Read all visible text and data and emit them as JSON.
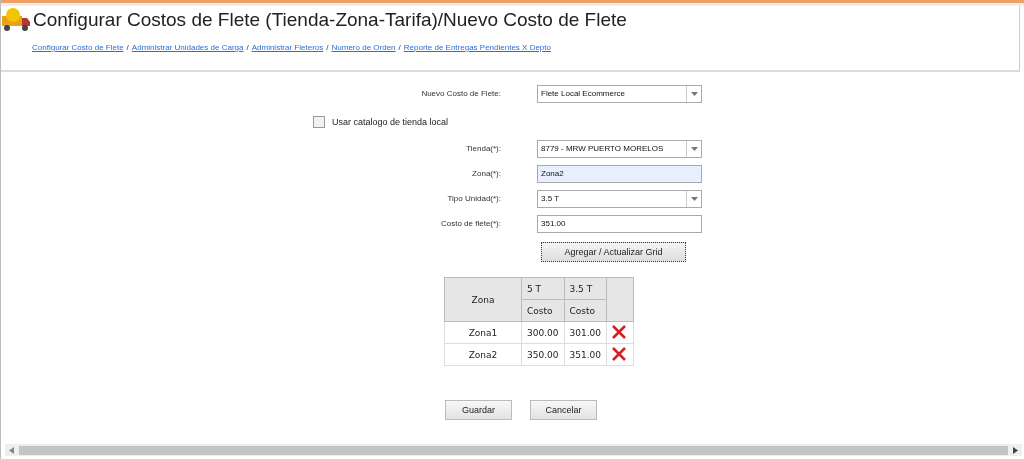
{
  "title": "Configurar Costos de Flete (Tienda-Zona-Tarifa)/Nuevo Costo de Flete",
  "breadcrumb_separator": "/",
  "breadcrumbs": [
    "Configurar Costo de Flete",
    "Administrar Unidades de Carga",
    "Administrar Fleteros",
    "Numero de Orden",
    "Reporte de Entregas Pendientes X Depto"
  ],
  "nuevo_costo": {
    "label": "Nuevo Costo de Flete:",
    "value": "Flete Local Ecommerce"
  },
  "usar_catalogo": {
    "label": "Usar catalogo de tienda local",
    "checked": false
  },
  "fields": [
    {
      "kind": "select",
      "label": "Tienda(*):",
      "value": "8779 - MRW PUERTO MORELOS"
    },
    {
      "kind": "input",
      "label": "Zona(*):",
      "value": "Zona2",
      "highlighted": true
    },
    {
      "kind": "select",
      "label": "Tipo Unidad(*):",
      "value": "3.5 T"
    },
    {
      "kind": "input",
      "label": "Costo de flete(*):",
      "value": "351.00",
      "highlighted": false
    }
  ],
  "add_button": "Agregar / Actualizar Grid",
  "table": {
    "zone_header": "Zona",
    "units": [
      {
        "name": "5 T",
        "sub": "Costo"
      },
      {
        "name": "3.5 T",
        "sub": "Costo"
      }
    ],
    "rows": [
      {
        "zona": "Zona1",
        "values": [
          "300.00",
          "301.00"
        ]
      },
      {
        "zona": "Zona2",
        "values": [
          "350.00",
          "351.00"
        ]
      }
    ]
  },
  "buttons": [
    "Guardar",
    "Cancelar"
  ]
}
